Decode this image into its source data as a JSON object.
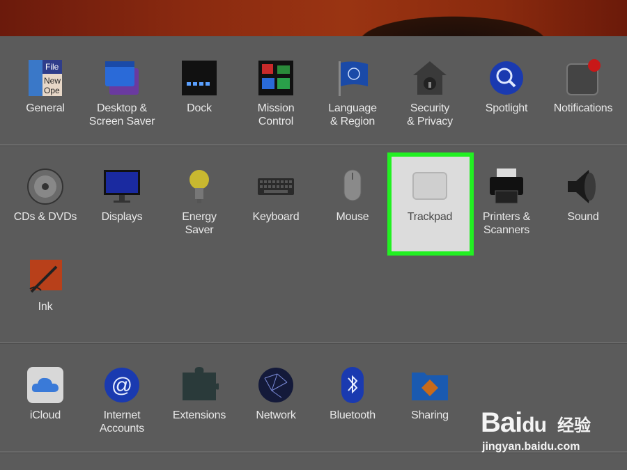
{
  "rows": [
    {
      "items": [
        {
          "id": "general",
          "label": "General"
        },
        {
          "id": "desktop",
          "label": "Desktop &\nScreen Saver"
        },
        {
          "id": "dock",
          "label": "Dock"
        },
        {
          "id": "mission",
          "label": "Mission\nControl"
        },
        {
          "id": "language",
          "label": "Language\n& Region"
        },
        {
          "id": "security",
          "label": "Security\n& Privacy"
        },
        {
          "id": "spotlight",
          "label": "Spotlight"
        },
        {
          "id": "notifications",
          "label": "Notifications"
        }
      ]
    },
    {
      "items": [
        {
          "id": "cds",
          "label": "CDs & DVDs"
        },
        {
          "id": "displays",
          "label": "Displays"
        },
        {
          "id": "energy",
          "label": "Energy\nSaver"
        },
        {
          "id": "keyboard",
          "label": "Keyboard"
        },
        {
          "id": "mouse",
          "label": "Mouse"
        },
        {
          "id": "trackpad",
          "label": "Trackpad"
        },
        {
          "id": "printers",
          "label": "Printers &\nScanners"
        },
        {
          "id": "sound",
          "label": "Sound"
        },
        {
          "id": "ink",
          "label": "Ink"
        }
      ]
    },
    {
      "items": [
        {
          "id": "icloud",
          "label": "iCloud"
        },
        {
          "id": "internet",
          "label": "Internet\nAccounts"
        },
        {
          "id": "extensions",
          "label": "Extensions"
        },
        {
          "id": "network",
          "label": "Network"
        },
        {
          "id": "bluetooth",
          "label": "Bluetooth"
        },
        {
          "id": "sharing",
          "label": "Sharing"
        }
      ]
    }
  ],
  "general_icon_text": [
    "File",
    "New",
    "Ope"
  ],
  "highlight_color": "#22f022",
  "watermark": {
    "brand": "Bai",
    "paw": "du",
    "cn": "经验",
    "url": "jingyan.baidu.com"
  }
}
